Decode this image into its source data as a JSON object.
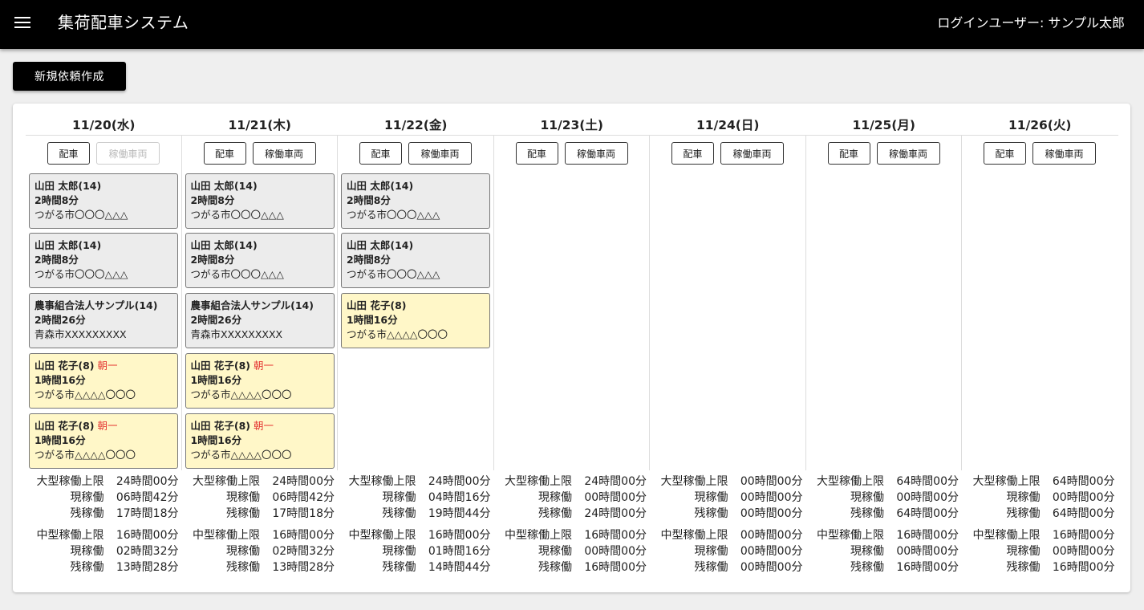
{
  "header": {
    "app_title": "集荷配車システム",
    "login_user": "ログインユーザー: サンプル太郎"
  },
  "actions": {
    "new_request_label": "新規依頼作成"
  },
  "buttons": {
    "dispatch_label": "配車",
    "vehicles_label": "稼働車両"
  },
  "labels": {
    "large_limit": "大型稼働上限",
    "medium_limit": "中型稼働上限",
    "current": "現稼働",
    "remaining": "残稼働"
  },
  "days": [
    {
      "date": "11/20(水)",
      "vehicles_disabled": true,
      "cards": [
        {
          "name": "山田 太郎(14)",
          "tag": "",
          "duration": "2時間8分",
          "address": "つがる市〇〇〇△△△",
          "color": "gray"
        },
        {
          "name": "山田 太郎(14)",
          "tag": "",
          "duration": "2時間8分",
          "address": "つがる市〇〇〇△△△",
          "color": "gray"
        },
        {
          "name": "農事組合法人サンプル(14)",
          "tag": "",
          "duration": "2時間26分",
          "address": "青森市XXXXXXXXX",
          "color": "gray"
        },
        {
          "name": "山田 花子(8)",
          "tag": "朝一",
          "duration": "1時間16分",
          "address": "つがる市△△△△〇〇〇",
          "color": "yellow"
        },
        {
          "name": "山田 花子(8)",
          "tag": "朝一",
          "duration": "1時間16分",
          "address": "つがる市△△△△〇〇〇",
          "color": "yellow"
        }
      ],
      "large": {
        "limit": "24時間00分",
        "current": "06時間42分",
        "remaining": "17時間18分"
      },
      "medium": {
        "limit": "16時間00分",
        "current": "02時間32分",
        "remaining": "13時間28分"
      }
    },
    {
      "date": "11/21(木)",
      "vehicles_disabled": false,
      "cards": [
        {
          "name": "山田 太郎(14)",
          "tag": "",
          "duration": "2時間8分",
          "address": "つがる市〇〇〇△△△",
          "color": "gray"
        },
        {
          "name": "山田 太郎(14)",
          "tag": "",
          "duration": "2時間8分",
          "address": "つがる市〇〇〇△△△",
          "color": "gray"
        },
        {
          "name": "農事組合法人サンプル(14)",
          "tag": "",
          "duration": "2時間26分",
          "address": "青森市XXXXXXXXX",
          "color": "gray"
        },
        {
          "name": "山田 花子(8)",
          "tag": "朝一",
          "duration": "1時間16分",
          "address": "つがる市△△△△〇〇〇",
          "color": "yellow"
        },
        {
          "name": "山田 花子(8)",
          "tag": "朝一",
          "duration": "1時間16分",
          "address": "つがる市△△△△〇〇〇",
          "color": "yellow"
        }
      ],
      "large": {
        "limit": "24時間00分",
        "current": "06時間42分",
        "remaining": "17時間18分"
      },
      "medium": {
        "limit": "16時間00分",
        "current": "02時間32分",
        "remaining": "13時間28分"
      }
    },
    {
      "date": "11/22(金)",
      "vehicles_disabled": false,
      "cards": [
        {
          "name": "山田 太郎(14)",
          "tag": "",
          "duration": "2時間8分",
          "address": "つがる市〇〇〇△△△",
          "color": "gray"
        },
        {
          "name": "山田 太郎(14)",
          "tag": "",
          "duration": "2時間8分",
          "address": "つがる市〇〇〇△△△",
          "color": "gray"
        },
        {
          "name": "山田 花子(8)",
          "tag": "",
          "duration": "1時間16分",
          "address": "つがる市△△△△〇〇〇",
          "color": "yellow"
        }
      ],
      "large": {
        "limit": "24時間00分",
        "current": "04時間16分",
        "remaining": "19時間44分"
      },
      "medium": {
        "limit": "16時間00分",
        "current": "01時間16分",
        "remaining": "14時間44分"
      }
    },
    {
      "date": "11/23(土)",
      "vehicles_disabled": false,
      "cards": [],
      "large": {
        "limit": "24時間00分",
        "current": "00時間00分",
        "remaining": "24時間00分"
      },
      "medium": {
        "limit": "16時間00分",
        "current": "00時間00分",
        "remaining": "16時間00分"
      }
    },
    {
      "date": "11/24(日)",
      "vehicles_disabled": false,
      "cards": [],
      "large": {
        "limit": "00時間00分",
        "current": "00時間00分",
        "remaining": "00時間00分"
      },
      "medium": {
        "limit": "00時間00分",
        "current": "00時間00分",
        "remaining": "00時間00分"
      }
    },
    {
      "date": "11/25(月)",
      "vehicles_disabled": false,
      "cards": [],
      "large": {
        "limit": "64時間00分",
        "current": "00時間00分",
        "remaining": "64時間00分"
      },
      "medium": {
        "limit": "16時間00分",
        "current": "00時間00分",
        "remaining": "16時間00分"
      }
    },
    {
      "date": "11/26(火)",
      "vehicles_disabled": false,
      "cards": [],
      "large": {
        "limit": "64時間00分",
        "current": "00時間00分",
        "remaining": "64時間00分"
      },
      "medium": {
        "limit": "16時間00分",
        "current": "00時間00分",
        "remaining": "16時間00分"
      }
    }
  ],
  "colors": {
    "appbar": "#000000",
    "card_gray": "#ececec",
    "card_yellow": "#fff7c8",
    "tag_red": "#e53935"
  }
}
